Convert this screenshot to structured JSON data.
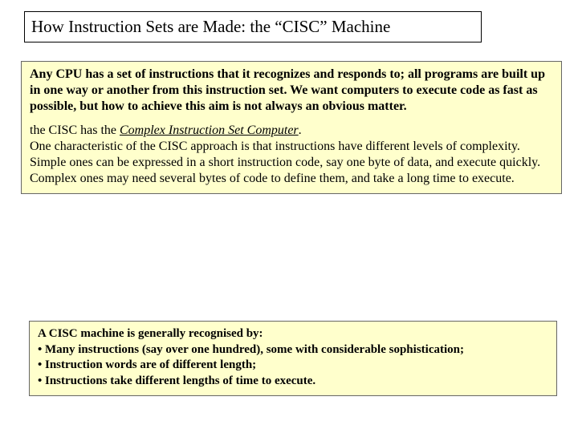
{
  "title": "How Instruction Sets are Made: the “CISC” Machine",
  "intro": "Any CPU has a set of instructions that it recognizes and responds to; all programs are built up in one way or another from this instruction set. We want computers to execute code as fast as possible, but how to achieve this aim is not always an obvious matter.",
  "cisc": {
    "prefix": "the CISC has  the ",
    "expansion": "Complex Instruction Set Computer",
    "period": ".",
    "rest": "One characteristic of the CISC approach is that instructions have different levels of complexity.\nSimple ones can be expressed in a short instruction code, say one byte of data, and execute quickly. Complex ones may need several bytes of code to define them, and take a long time to execute."
  },
  "recog": {
    "lead": "A CISC machine is generally recognised by:",
    "b1": "• Many instructions (say over one hundred), some with considerable sophistication;",
    "b2": "• Instruction words are of different length;",
    "b3": "• Instructions take different lengths of time to execute."
  }
}
